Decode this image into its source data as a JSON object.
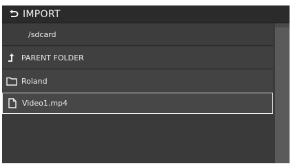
{
  "header": {
    "title": "IMPORT",
    "back_icon": "return-arrow-icon"
  },
  "list": {
    "path": "/sdcard",
    "items": [
      {
        "label": "PARENT FOLDER",
        "icon": "up-arrow-icon"
      },
      {
        "label": "Roland",
        "icon": "folder-icon"
      },
      {
        "label": "Video1.mp4",
        "icon": "file-icon",
        "selected": true
      }
    ]
  }
}
